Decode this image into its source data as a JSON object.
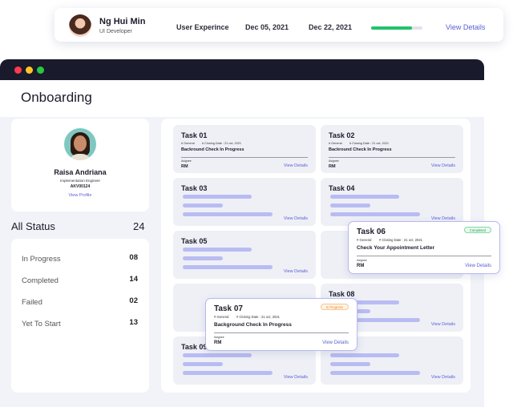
{
  "top_row": {
    "name": "Ng Hui Min",
    "role": "UI Developer",
    "project": "User Experince",
    "start_date": "Dec 05, 2021",
    "end_date": "Dec 22, 2021",
    "progress": 0.8,
    "link": "View Details"
  },
  "window": {
    "title": "Onboarding"
  },
  "profile": {
    "name": "Raisa Andriana",
    "title": "Implementation Engineer",
    "id": "AKV00124",
    "link": "View Profile"
  },
  "all_status": {
    "label": "All Status",
    "count": "24"
  },
  "statuses": [
    {
      "label": "In Progress",
      "value": "08"
    },
    {
      "label": "Completed",
      "value": "14"
    },
    {
      "label": "Failed",
      "value": "02"
    },
    {
      "label": "Yet To Start",
      "value": "13"
    }
  ],
  "tasks": {
    "t01": {
      "title": "Task 01",
      "tag": "# General",
      "closing": "# Closing Date : 21 oct, 2021",
      "desc": "Backround Check In Progress",
      "assignee_label": "Asignee",
      "assignee": "RM",
      "link": "View Details"
    },
    "t02": {
      "title": "Task 02",
      "tag": "# General",
      "closing": "# Closing Date : 21 oct, 2021",
      "desc": "Backround Check In Progress",
      "assignee_label": "Asignee",
      "assignee": "RM",
      "link": "View Details"
    },
    "t03": {
      "title": "Task 03",
      "link": "View Details"
    },
    "t04": {
      "title": "Task 04",
      "link": "View Details"
    },
    "t05": {
      "title": "Task 05",
      "link": "View Details"
    },
    "t08": {
      "title": "Task 08",
      "link": "View Details"
    },
    "t09": {
      "title": "Task 09",
      "link": "View Details"
    },
    "t10": {
      "link": "View Details"
    },
    "t06": {
      "title": "Task 06",
      "badge": "Completed",
      "tag": "# General",
      "closing": "# Closing Date : 21 oct, 2021",
      "desc": "Check Your Appointment Letter",
      "assignee_label": "Asignee",
      "assignee": "RM",
      "link": "View Details"
    },
    "t07": {
      "title": "Task 07",
      "badge": "In Progress",
      "tag": "# General",
      "closing": "# Closing Date : 21 oct, 2021",
      "desc": "Background Check In Progress",
      "assignee_label": "Asignee",
      "assignee": "RM",
      "link": "View Details"
    }
  },
  "colors": {
    "accent": "#5b5fd6",
    "progress_green": "#21c36b",
    "titlebar": "#191a2c",
    "dot_red": "#ff3b4e",
    "dot_yellow": "#ffc527",
    "dot_green": "#28c940"
  }
}
